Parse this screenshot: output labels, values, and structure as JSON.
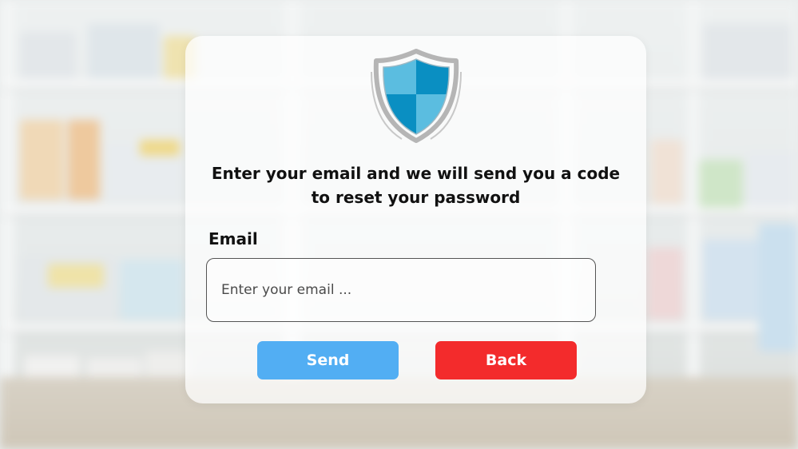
{
  "card": {
    "icon": "shield-icon",
    "title": "Enter your email and we will send you a code to reset your password"
  },
  "form": {
    "email_label": "Email",
    "email_placeholder": "Enter your email ...",
    "email_value": ""
  },
  "actions": {
    "send_label": "Send",
    "back_label": "Back"
  },
  "colors": {
    "send_button": "#52aef3",
    "back_button": "#f32b2c",
    "shield_dark": "#0a8fc2",
    "shield_light": "#5bbde0",
    "shield_border": "#a9a9a9"
  }
}
